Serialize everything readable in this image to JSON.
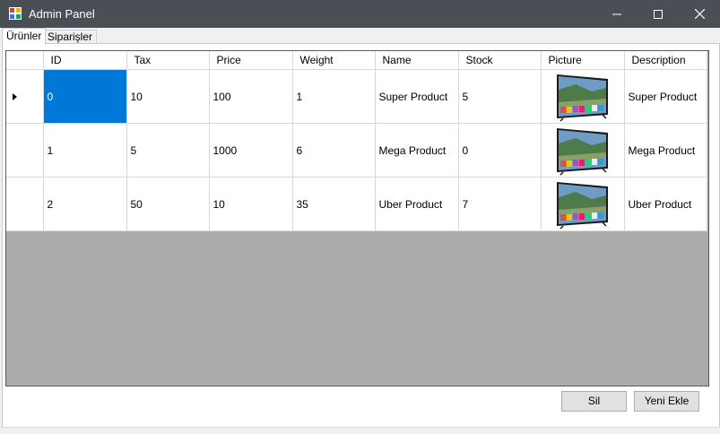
{
  "window": {
    "title": "Admin Panel",
    "minimize_icon": "minimize-icon",
    "maximize_icon": "maximize-icon",
    "close_icon": "close-icon"
  },
  "tabs": [
    {
      "label": "Ürünler",
      "active": true
    },
    {
      "label": "Siparişler",
      "active": false
    }
  ],
  "grid": {
    "columns": [
      "ID",
      "Tax",
      "Price",
      "Weight",
      "Name",
      "Stock",
      "Picture",
      "Description"
    ],
    "selected_row": 0,
    "rows": [
      {
        "id": "0",
        "tax": "10",
        "price": "100",
        "weight": "1",
        "name": "Super Product",
        "stock": "5",
        "picture": "tv-image",
        "description": "Super Product"
      },
      {
        "id": "1",
        "tax": "5",
        "price": "1000",
        "weight": "6",
        "name": "Mega Product",
        "stock": "0",
        "picture": "tv-image",
        "description": "Mega Product"
      },
      {
        "id": "2",
        "tax": "50",
        "price": "10",
        "weight": "35",
        "name": "Uber Product",
        "stock": "7",
        "picture": "tv-image",
        "description": "Uber Product"
      }
    ]
  },
  "buttons": {
    "delete_label": "Sil",
    "add_label": "Yeni Ekle"
  },
  "colors": {
    "titlebar": "#4a4f55",
    "selection": "#0078d7",
    "grid_background": "#ababab"
  }
}
